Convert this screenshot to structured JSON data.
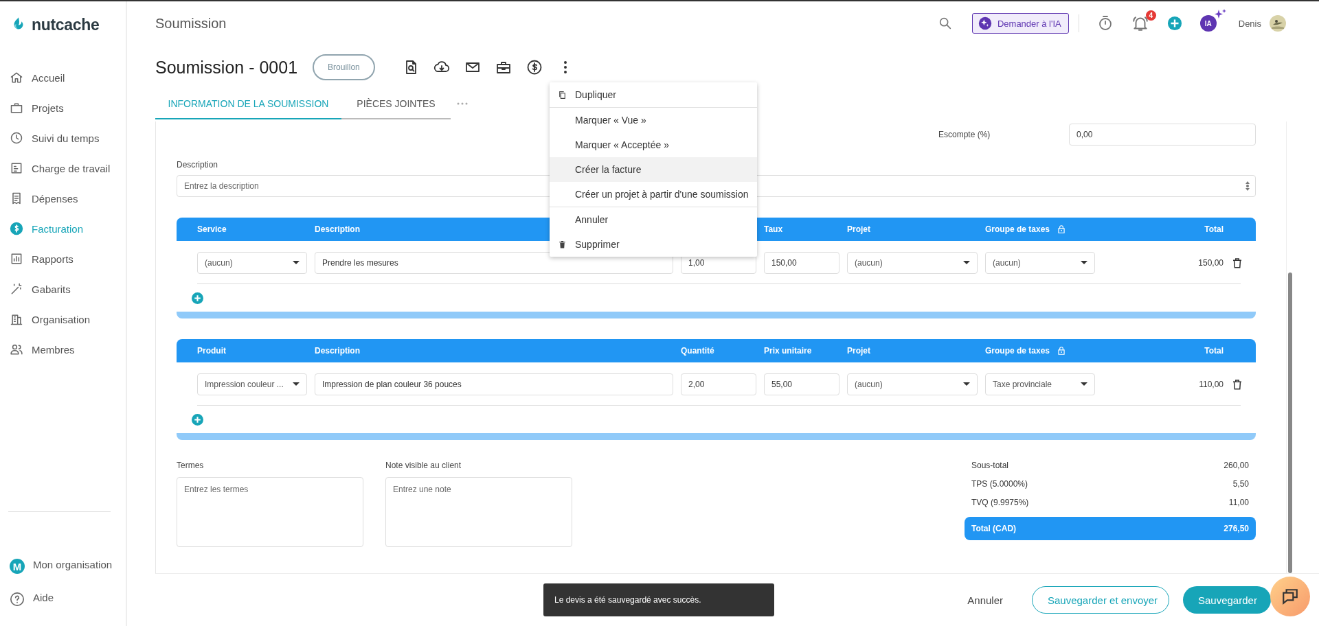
{
  "sidebar": {
    "logo": "nutcache",
    "items": [
      {
        "label": "Accueil",
        "selected": false
      },
      {
        "label": "Projets",
        "selected": false
      },
      {
        "label": "Suivi du temps",
        "selected": false
      },
      {
        "label": "Charge de travail",
        "selected": false
      },
      {
        "label": "Dépenses",
        "selected": false
      },
      {
        "label": "Facturation",
        "selected": true
      },
      {
        "label": "Rapports",
        "selected": false
      },
      {
        "label": "Gabarits",
        "selected": false
      },
      {
        "label": "Organisation",
        "selected": false
      },
      {
        "label": "Membres",
        "selected": false
      }
    ],
    "bottom_items": [
      {
        "label": "Mon organisation",
        "avatar_letter": "M"
      },
      {
        "label": "Aide"
      }
    ]
  },
  "header": {
    "title": "Soumission",
    "ai_button": "Demander à l'IA",
    "notification_count": "4",
    "ai_avatar": "IA",
    "user_name": "Denis"
  },
  "document": {
    "title": "Soumission - 0001",
    "status": "Brouillon"
  },
  "tabs": [
    {
      "label": "INFORMATION DE LA SOUMISSION",
      "selected": true
    },
    {
      "label": "PIÈCES JOINTES",
      "selected": false
    }
  ],
  "menu": {
    "sections": [
      [
        {
          "label": "Dupliquer",
          "hovered": false
        }
      ],
      [
        {
          "label": "Marquer « Vue »",
          "hovered": false
        },
        {
          "label": "Marquer « Acceptée »",
          "hovered": false
        },
        {
          "label": "Créer la facture",
          "hovered": true
        },
        {
          "label": "Créer un projet à partir d'une soumission",
          "hovered": false
        }
      ],
      [
        {
          "label": "Annuler",
          "hovered": false
        },
        {
          "label": "Supprimer",
          "hovered": false
        }
      ]
    ]
  },
  "form": {
    "discount_label": "Escompte (%)",
    "discount_value": "0,00",
    "description_label": "Description",
    "description_placeholder": "Entrez la description"
  },
  "tables": [
    {
      "columns": [
        {
          "kind": "item",
          "label": "Service"
        },
        {
          "kind": "description",
          "label": "Description"
        },
        {
          "kind": "rate",
          "label": "Taux"
        },
        {
          "kind": "project",
          "label": "Projet"
        },
        {
          "kind": "tax",
          "label": "Groupe de taxes"
        },
        {
          "kind": "total",
          "label": "Total"
        }
      ],
      "rows": [
        {
          "item": "(aucun)",
          "description": "Prendre les mesures",
          "quantity": "1,00",
          "rate": "150,00",
          "project": "(aucun)",
          "tax_group": "(aucun)",
          "total": "150,00"
        }
      ]
    },
    {
      "columns": [
        {
          "kind": "item",
          "label": "Produit"
        },
        {
          "kind": "description",
          "label": "Description"
        },
        {
          "kind": "quantity",
          "label": "Quantité"
        },
        {
          "kind": "rate",
          "label": "Prix unitaire"
        },
        {
          "kind": "project",
          "label": "Projet"
        },
        {
          "kind": "tax",
          "label": "Groupe de taxes"
        },
        {
          "kind": "total",
          "label": "Total"
        }
      ],
      "rows": [
        {
          "item": "Impression couleur ...",
          "description": "Impression de plan couleur 36 pouces",
          "quantity": "2,00",
          "rate": "55,00",
          "project": "(aucun)",
          "tax_group": "Taxe provinciale",
          "total": "110,00"
        }
      ]
    }
  ],
  "notes": {
    "terms_label": "Termes",
    "terms_placeholder": "Entrez les termes",
    "note_label": "Note visible au client",
    "note_placeholder": "Entrez une note"
  },
  "summary": {
    "rows": [
      {
        "label": "Sous-total",
        "value": "260,00"
      },
      {
        "label": "TPS (5.0000%)",
        "value": "5,50"
      },
      {
        "label": "TVQ (9.9975%)",
        "value": "11,00"
      }
    ],
    "total": {
      "label": "Total (CAD)",
      "value": "276,50"
    }
  },
  "footer": {
    "buttons": [
      {
        "label": "Annuler",
        "kind": "text"
      },
      {
        "label": "Sauvegarder et envoyer",
        "kind": "outline"
      },
      {
        "label": "Sauvegarder",
        "kind": "primary"
      }
    ]
  },
  "toast": {
    "text": "Le devis a été sauvegardé avec succès."
  }
}
